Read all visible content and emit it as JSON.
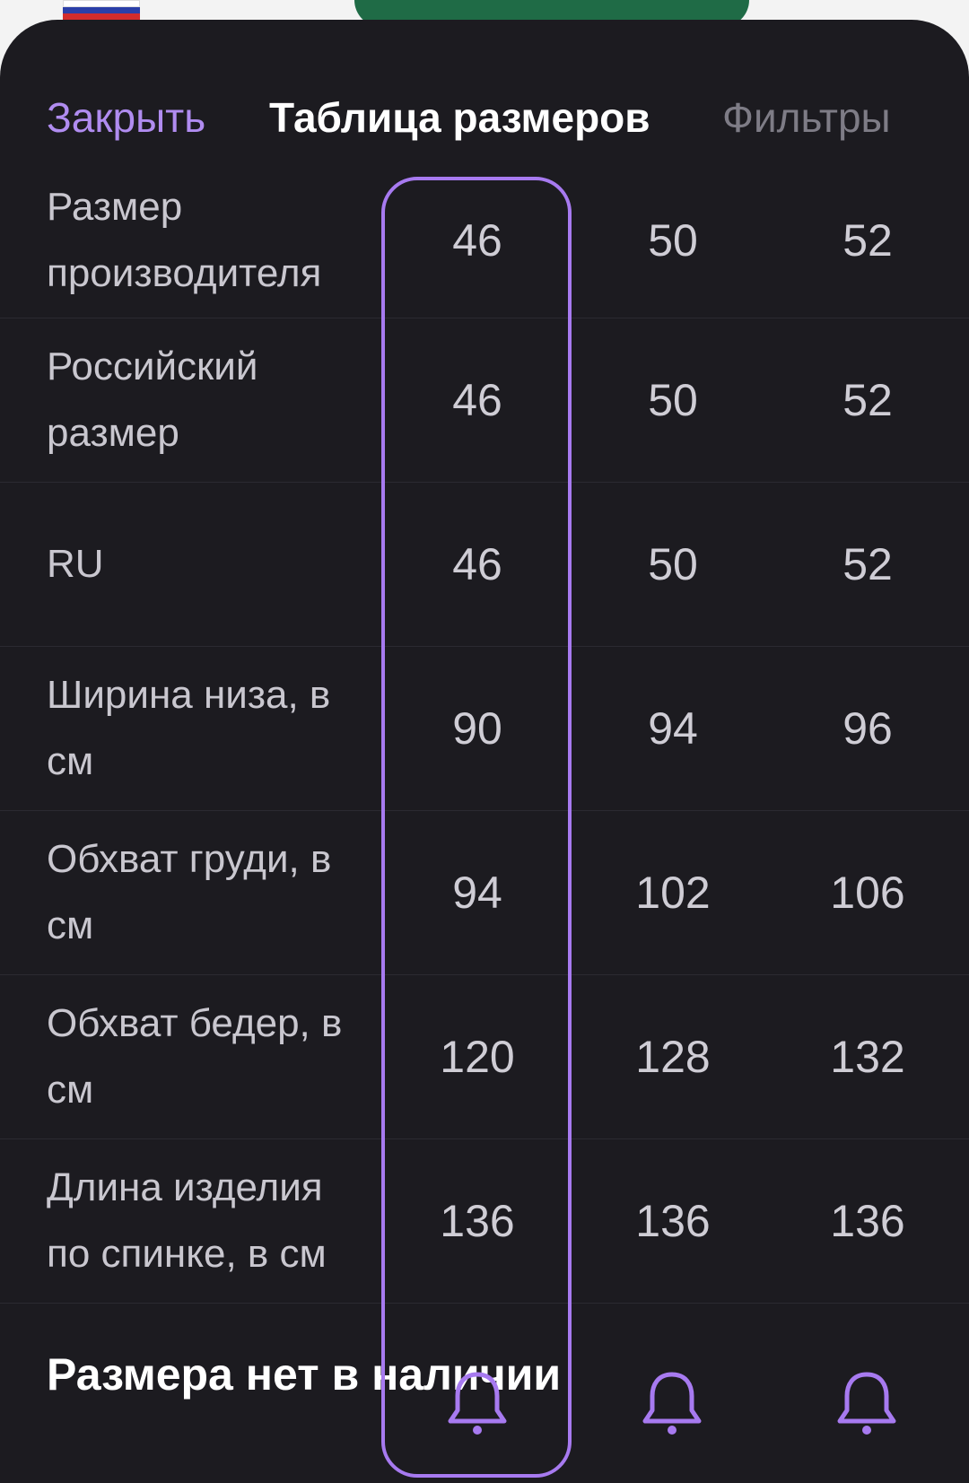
{
  "header": {
    "close_label": "Закрыть",
    "title": "Таблица размеров",
    "filters_label": "Фильтры"
  },
  "rows": [
    {
      "label": "Размер производителя",
      "values": [
        "46",
        "50",
        "52"
      ]
    },
    {
      "label": "Российский размер",
      "values": [
        "46",
        "50",
        "52"
      ]
    },
    {
      "label": "RU",
      "values": [
        "46",
        "50",
        "52"
      ]
    },
    {
      "label": "Ширина низа, в см",
      "values": [
        "90",
        "94",
        "96"
      ]
    },
    {
      "label": "Обхват груди, в см",
      "values": [
        "94",
        "102",
        "106"
      ]
    },
    {
      "label": "Обхват бедер, в см",
      "values": [
        "120",
        "128",
        "132"
      ]
    },
    {
      "label": "Длина изделия по спинке, в см",
      "values": [
        "136",
        "136",
        "136"
      ]
    }
  ],
  "footer": {
    "not_available_text": "Размера нет в наличии",
    "bell_icons": [
      "bell-icon",
      "bell-icon",
      "bell-icon"
    ]
  },
  "colors": {
    "accent": "#a77af0",
    "sheet_background": "#1c1b20"
  }
}
